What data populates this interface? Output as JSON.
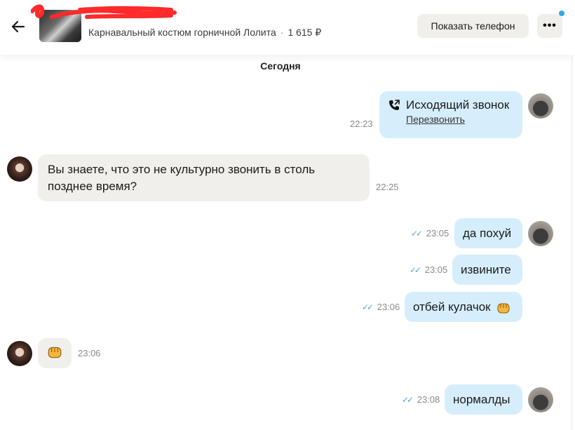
{
  "header": {
    "listing_title": "Карнавальный костюм горничной Лолита",
    "separator": "·",
    "price": "1 615 ₽",
    "phone_button": "Показать телефон",
    "more_button": "•••"
  },
  "date_divider": "Сегодня",
  "colors": {
    "outgoing_bubble": "#d6eefc",
    "incoming_bubble": "#f1efeb",
    "read_tick": "#5aa6d6",
    "notification_dot": "#2ba8f0"
  },
  "messages": [
    {
      "direction": "out",
      "type": "call",
      "title": "Исходящий звонок",
      "link": "Перезвонить",
      "time": "22:23",
      "icon": "phone-outgoing-icon"
    },
    {
      "direction": "in",
      "line1": "Вы знаете, что это не культурно звонить в столь",
      "line2": "позднее время?",
      "time": "22:25"
    },
    {
      "direction": "out",
      "text": "да похуй",
      "time": "23:05",
      "read": true
    },
    {
      "direction": "out",
      "text": "извините",
      "time": "23:05",
      "read": true
    },
    {
      "direction": "out",
      "text": "отбей кулачок",
      "emoji": "fist-bump-icon",
      "time": "23:06",
      "read": true
    },
    {
      "direction": "in",
      "emoji": "fist-bump-icon",
      "time": "23:06"
    },
    {
      "direction": "out",
      "text": "нормалды",
      "time": "23:08",
      "read": true
    }
  ],
  "ticks": "✓✓"
}
